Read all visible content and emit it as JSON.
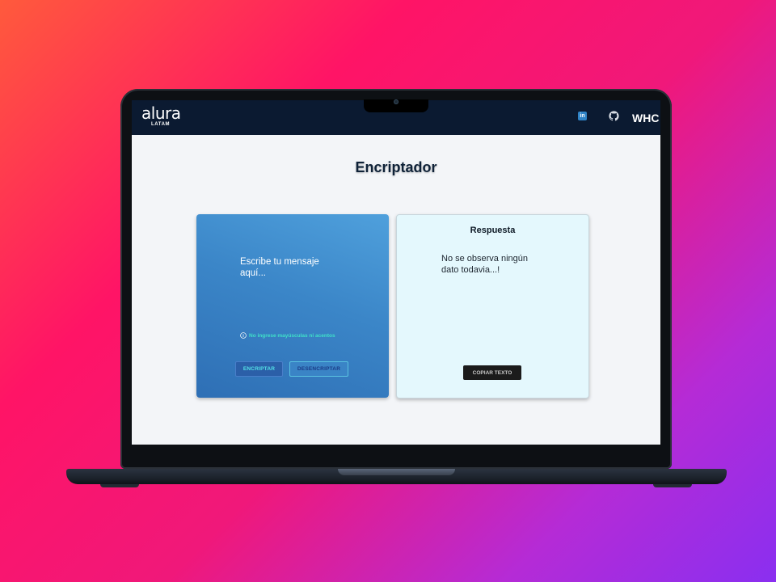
{
  "header": {
    "logo_text": "alura",
    "logo_sub": "LATAM",
    "linkedin_label": "in",
    "nav_initials": "WHC"
  },
  "main": {
    "title": "Encriptador",
    "input": {
      "placeholder": "Escribe tu mensaje aquí..."
    },
    "warning": "No ingrese mayúsculas ni acentos",
    "buttons": {
      "encrypt": "ENCRIPTAR",
      "decrypt": "DESENCRIPTAR"
    },
    "output": {
      "title": "Respuesta",
      "message": "No se observa ningún dato todavia...!",
      "copy_button": "COPIAR TEXTO"
    }
  },
  "icons": {
    "linkedin": "linkedin-icon",
    "github": "github-icon",
    "info": "info-icon"
  },
  "colors": {
    "header_bg": "#0b1a31",
    "card_gradient_start": "#4fa0dc",
    "card_gradient_end": "#2e6fb5",
    "warning_text": "#3fe0c8",
    "output_bg": "#e4f8fd"
  }
}
